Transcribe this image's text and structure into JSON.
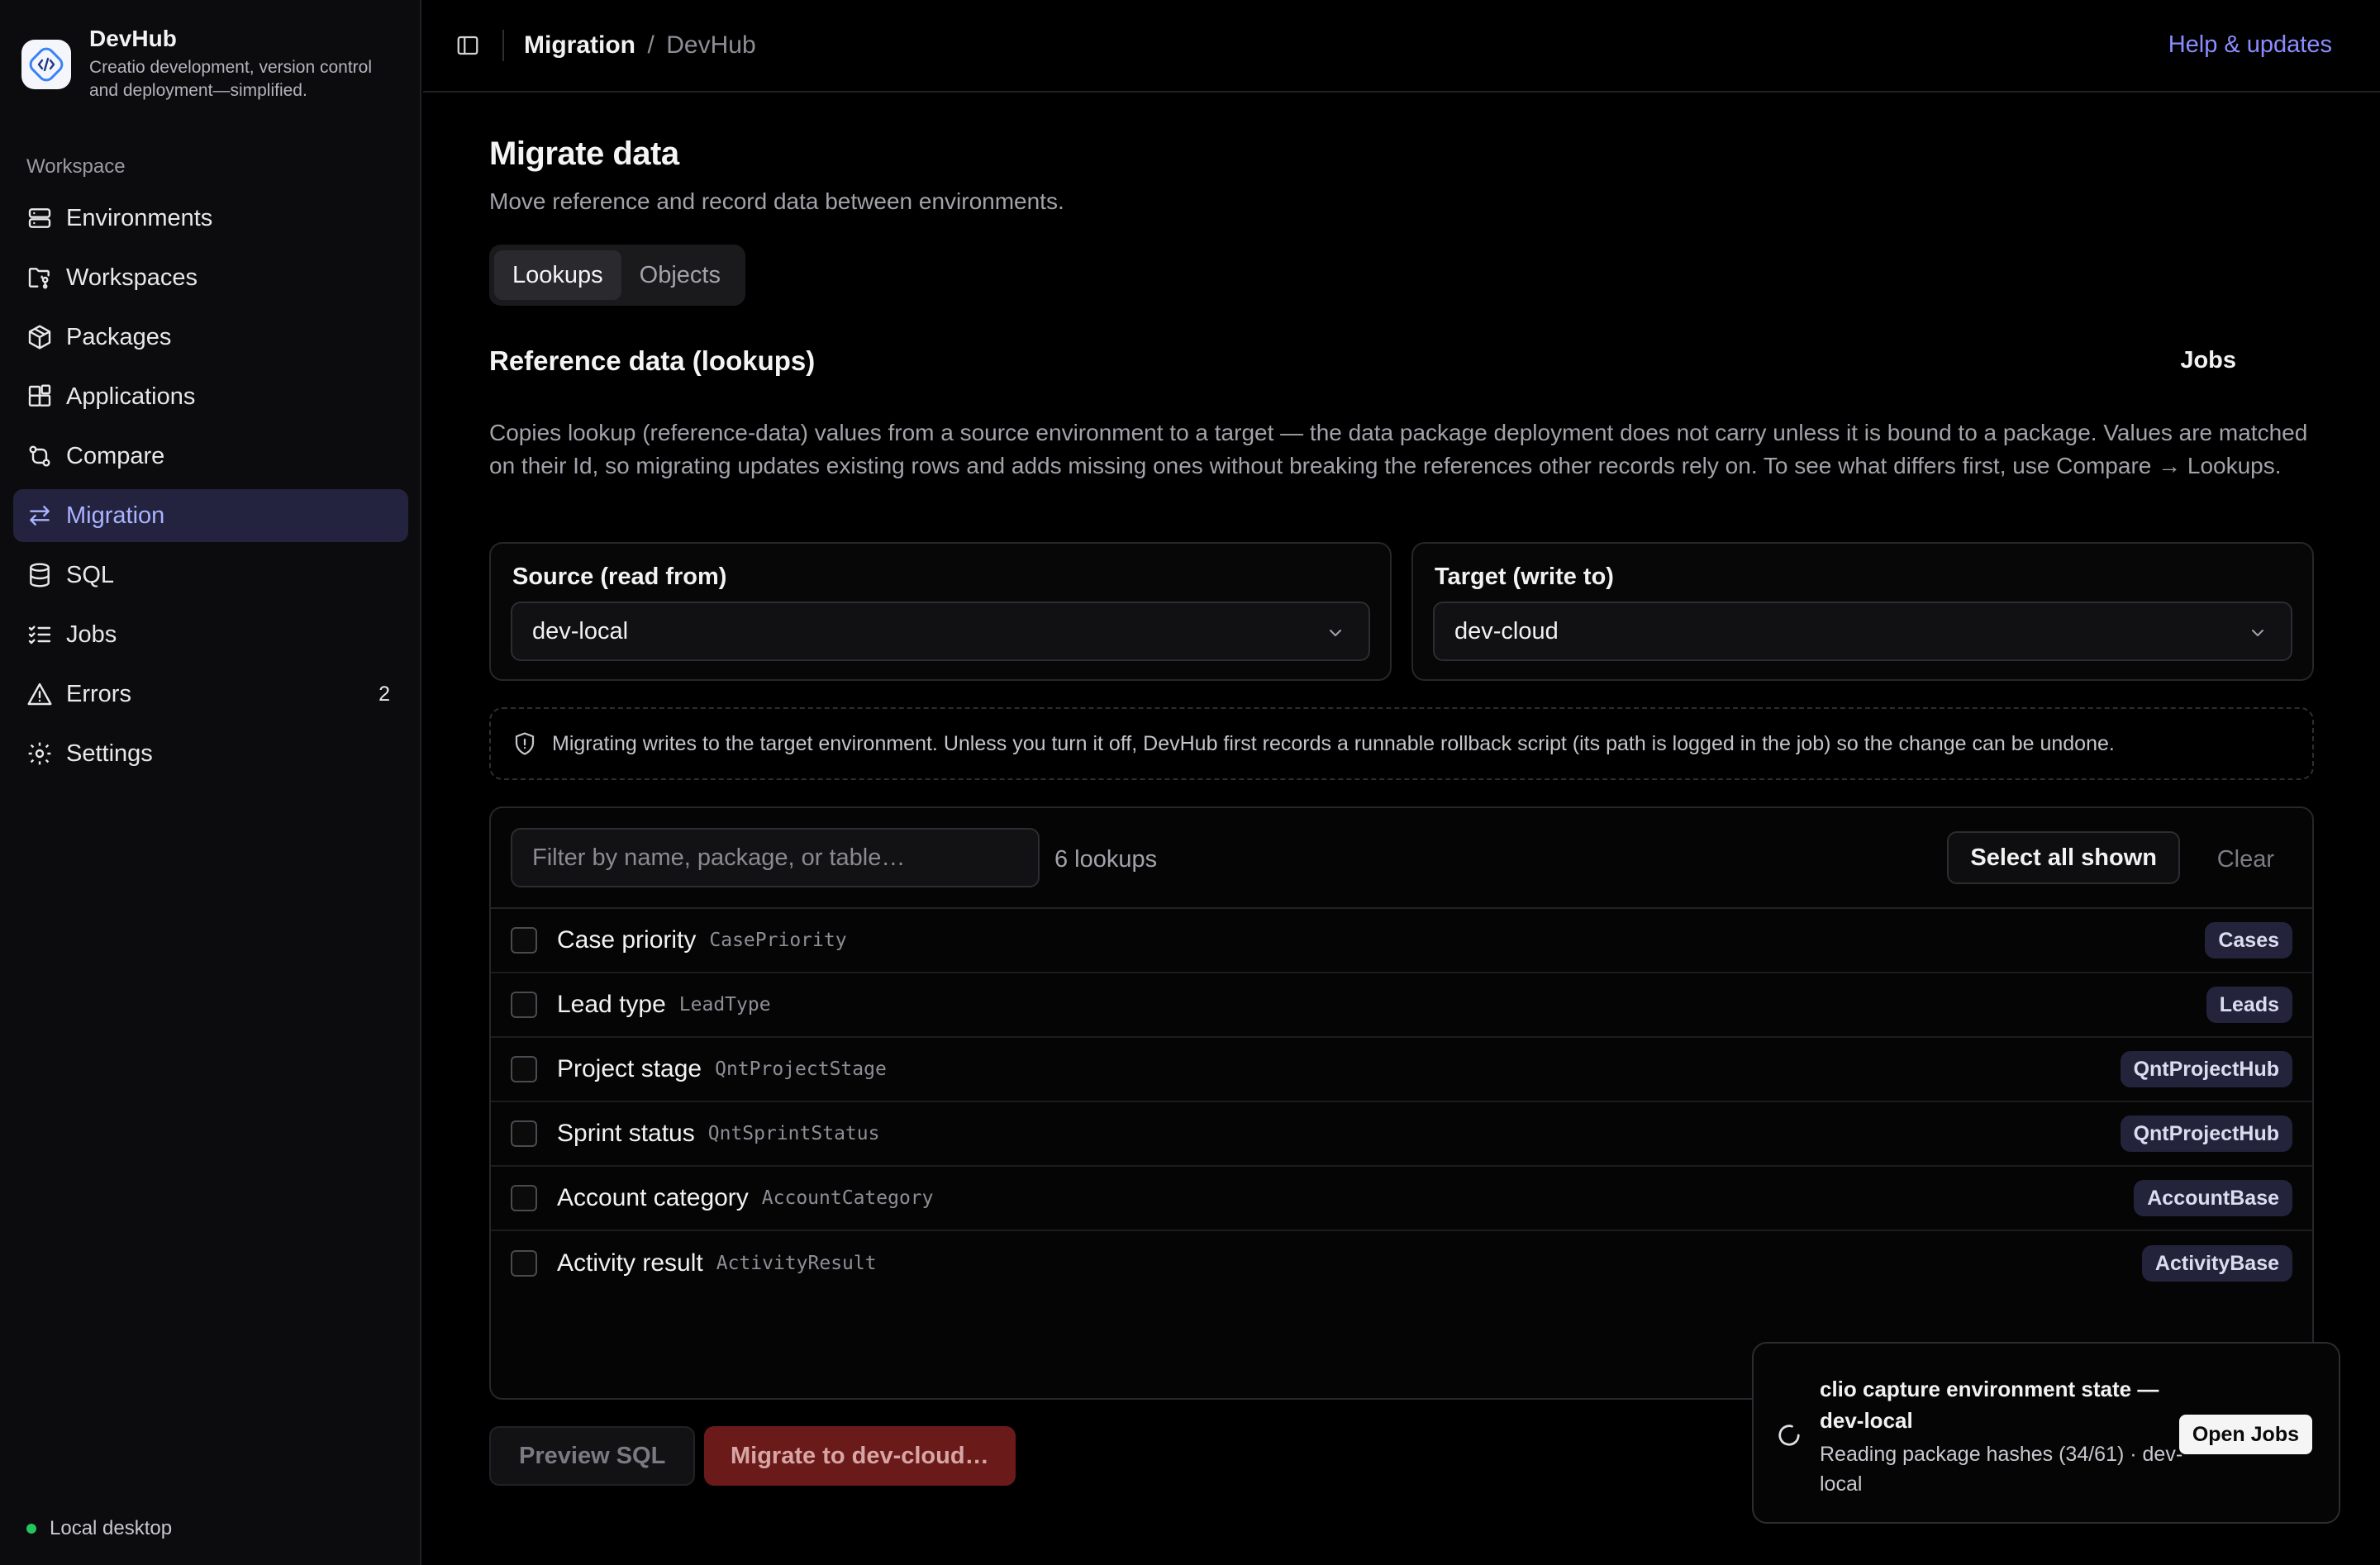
{
  "brand": {
    "name": "DevHub",
    "tagline": "Creatio development, version control and deployment—simplified."
  },
  "sidebar": {
    "section_label": "Workspace",
    "items": [
      {
        "label": "Environments",
        "icon": "server-icon"
      },
      {
        "label": "Workspaces",
        "icon": "folder-git-icon"
      },
      {
        "label": "Packages",
        "icon": "package-icon"
      },
      {
        "label": "Applications",
        "icon": "blocks-icon"
      },
      {
        "label": "Compare",
        "icon": "git-compare-icon"
      },
      {
        "label": "Migration",
        "icon": "arrow-left-right-icon",
        "active": true
      },
      {
        "label": "SQL",
        "icon": "database-icon"
      },
      {
        "label": "Jobs",
        "icon": "list-checks-icon"
      },
      {
        "label": "Errors",
        "icon": "alert-triangle-icon",
        "count": "2"
      },
      {
        "label": "Settings",
        "icon": "gear-icon"
      }
    ],
    "footer": "Local desktop"
  },
  "header": {
    "breadcrumb_main": "Migration",
    "breadcrumb_separator": "/",
    "breadcrumb_sub": "DevHub",
    "help_link": "Help & updates"
  },
  "main": {
    "title": "Migrate data",
    "subtitle": "Move reference and record data between environments.",
    "tabs": [
      {
        "label": "Lookups",
        "active": true
      },
      {
        "label": "Objects",
        "active": false
      }
    ],
    "section_title": "Reference data (lookups)",
    "jobs_link": "Jobs",
    "description": "Copies lookup (reference-data) values from a source environment to a target — the data package deployment does not carry unless it is bound to a package. Values are matched on their Id, so migrating updates existing rows and adds missing ones without breaking the references other records rely on. To see what differs first, use Compare → Lookups.",
    "source": {
      "label": "Source (read from)",
      "value": "dev-local"
    },
    "target": {
      "label": "Target (write to)",
      "value": "dev-cloud"
    },
    "warning": "Migrating writes to the target environment. Unless you turn it off, DevHub first records a runnable rollback script (its path is logged in the job) so the change can be undone.",
    "filter": {
      "placeholder": "Filter by name, package, or table…",
      "value": ""
    },
    "lookup_count": "6 lookups",
    "select_all_label": "Select all shown",
    "clear_label": "Clear",
    "lookups": [
      {
        "name": "Case priority",
        "code": "CasePriority",
        "package": "Cases"
      },
      {
        "name": "Lead type",
        "code": "LeadType",
        "package": "Leads"
      },
      {
        "name": "Project stage",
        "code": "QntProjectStage",
        "package": "QntProjectHub"
      },
      {
        "name": "Sprint status",
        "code": "QntSprintStatus",
        "package": "QntProjectHub"
      },
      {
        "name": "Account category",
        "code": "AccountCategory",
        "package": "AccountBase"
      },
      {
        "name": "Activity result",
        "code": "ActivityResult",
        "package": "ActivityBase"
      }
    ],
    "preview_label": "Preview SQL",
    "migrate_label": "Migrate to dev-cloud…"
  },
  "toast": {
    "title": "clio capture environment state — dev-local",
    "body": "Reading package hashes (34/61) · dev-local",
    "button": "Open Jobs"
  },
  "colors": {
    "accent": "#8a8cff",
    "active_nav_bg": "#23233f",
    "danger_button": "#6b1a1a",
    "status_online": "#22c55e"
  }
}
